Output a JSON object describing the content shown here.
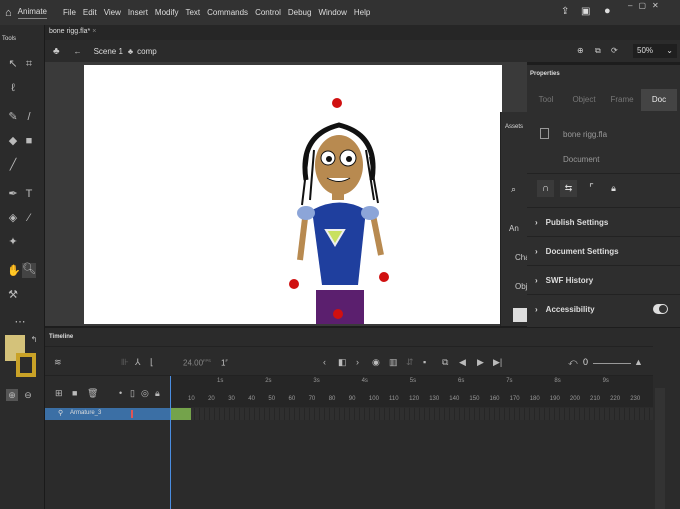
{
  "app": {
    "name": "Animate",
    "menu": [
      "File",
      "Edit",
      "View",
      "Insert",
      "Modify",
      "Text",
      "Commands",
      "Control",
      "Debug",
      "Window",
      "Help"
    ]
  },
  "document_tab": {
    "label": "bone rigg.fla*",
    "close": "×"
  },
  "tools_panel": {
    "title": "Tools"
  },
  "scene_bar": {
    "scene": "Scene 1",
    "symbol": "comp",
    "zoom": "50%"
  },
  "properties": {
    "title": "Properties",
    "tabs": [
      "Tool",
      "Object",
      "Frame",
      "Doc"
    ],
    "active_tab": "Doc",
    "file_name": "bone rigg.fla",
    "doc_label": "Document",
    "sections": [
      "Publish Settings",
      "Document Settings",
      "SWF History",
      "Accessibility"
    ]
  },
  "assets": {
    "title": "Assets",
    "items": [
      "An",
      "Cha",
      "Obj"
    ]
  },
  "timeline": {
    "title": "Timeline",
    "fps": "24.00",
    "fps_unit": "FPS",
    "frame": "1",
    "frame_unit": "F",
    "speed": "0",
    "layer": "Armature_3",
    "seconds": [
      "1s",
      "2s",
      "3s",
      "4s",
      "5s",
      "6s",
      "7s",
      "8s",
      "9s"
    ],
    "frame_ticks": [
      "10",
      "20",
      "30",
      "40",
      "50",
      "60",
      "70",
      "80",
      "90",
      "100",
      "110",
      "120",
      "130",
      "140",
      "150",
      "160",
      "170",
      "180",
      "190",
      "200",
      "210",
      "220",
      "230"
    ]
  },
  "colors": {
    "accent": "#2d6ca8",
    "layer_row": "#3b6fa5",
    "frame_green": "#74a34b",
    "stroke_swatch": "#d4c27a",
    "fill_swatch": "#c9a227",
    "joint_red": "#d01010"
  }
}
